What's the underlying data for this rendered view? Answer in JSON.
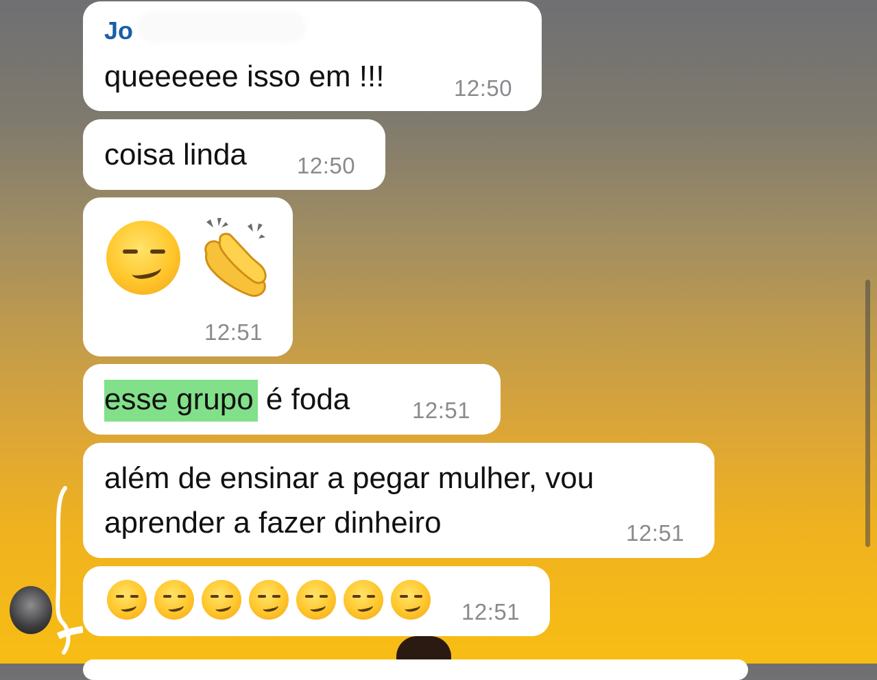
{
  "chat": {
    "messages": [
      {
        "sender": "Jo",
        "text": "queeeeee isso em !!!",
        "time": "12:50"
      },
      {
        "text": "coisa linda",
        "time": "12:50"
      },
      {
        "emoji": [
          "smirking-face",
          "clapping-hands"
        ],
        "time": "12:51"
      },
      {
        "highlighted_text": "esse grupo",
        "text_rest": " é foda",
        "time": "12:51"
      },
      {
        "line1": "além de ensinar a pegar mulher, vou",
        "line2": "aprender a fazer dinheiro",
        "time": "12:51"
      },
      {
        "emoji": [
          "smirking-face",
          "smirking-face",
          "smirking-face",
          "smirking-face",
          "smirking-face",
          "smirking-face",
          "smirking-face"
        ],
        "time": "12:51"
      }
    ]
  },
  "colors": {
    "bubble": "#ffffff",
    "sender_name": "#1a5ea8",
    "timestamp": "#8a8a8e",
    "highlight": "#82e08a"
  }
}
